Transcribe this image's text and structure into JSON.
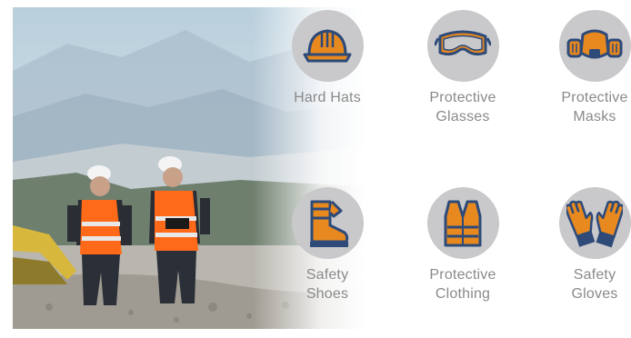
{
  "colors": {
    "icon_fill": "#e8891f",
    "icon_stroke": "#2d4a79",
    "circle": "#c9c9cb",
    "label": "#8a8a8a"
  },
  "photo": {
    "icon": "construction-workers-photo"
  },
  "items": [
    {
      "icon": "hard-hat-icon",
      "line1": "Hard Hats",
      "line2": ""
    },
    {
      "icon": "protective-glasses-icon",
      "line1": "Protective",
      "line2": "Glasses"
    },
    {
      "icon": "gas-mask-icon",
      "line1": "Protective",
      "line2": "Masks"
    },
    {
      "icon": "safety-boot-icon",
      "line1": "Safety",
      "line2": "Shoes"
    },
    {
      "icon": "safety-vest-icon",
      "line1": "Protective",
      "line2": "Clothing"
    },
    {
      "icon": "gloves-icon",
      "line1": "Safety",
      "line2": "Gloves"
    }
  ]
}
